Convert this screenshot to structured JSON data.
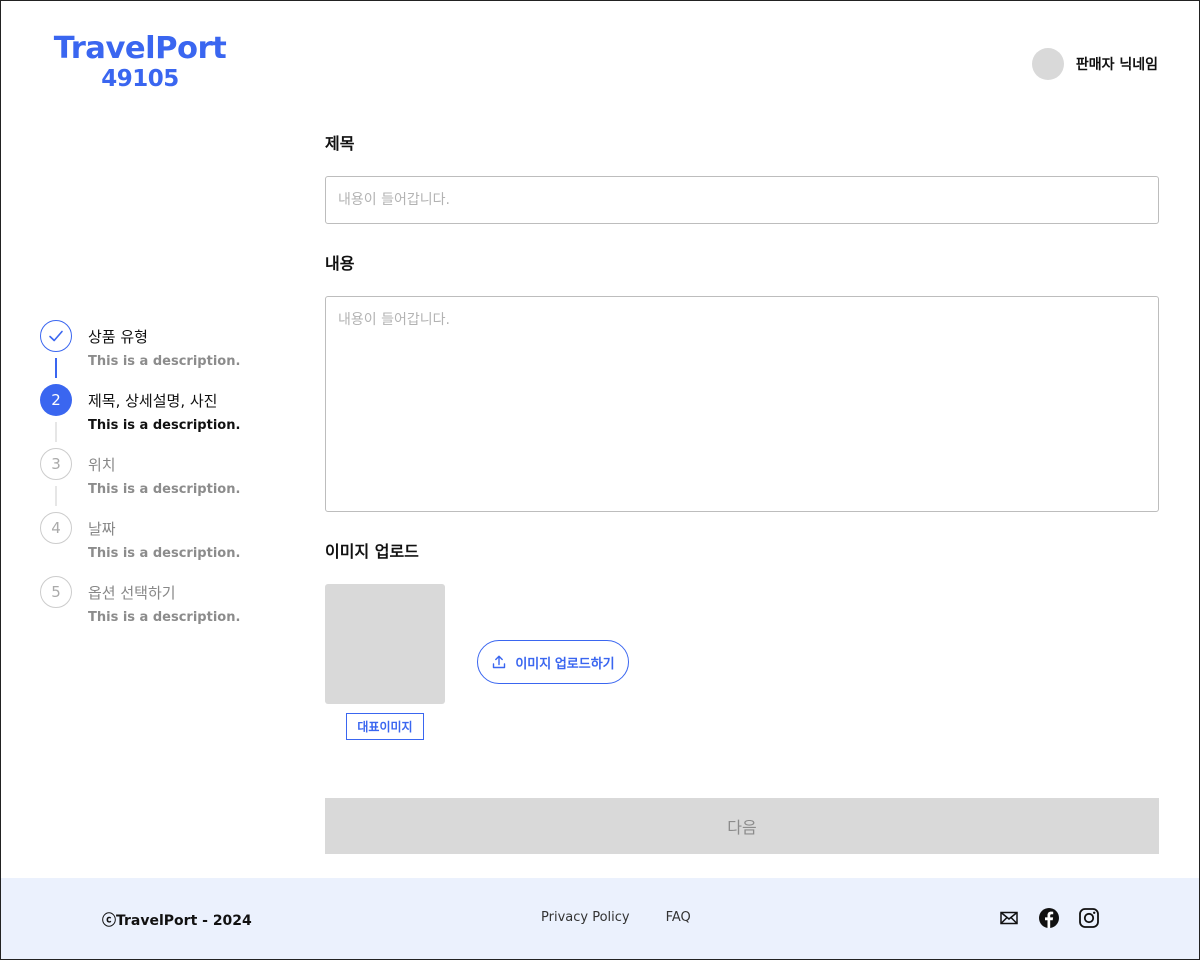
{
  "header": {
    "logo_line1": "TravelPort",
    "logo_line2": "49105",
    "seller_name": "판매자 닉네임"
  },
  "stepper": {
    "steps": [
      {
        "title": "상품 유형",
        "description": "This is a description.",
        "state": "done"
      },
      {
        "title": "제목, 상세설명, 사진",
        "description": "This is a description.",
        "state": "active",
        "number": "2"
      },
      {
        "title": "위치",
        "description": "This is a description.",
        "state": "todo",
        "number": "3"
      },
      {
        "title": "날짜",
        "description": "This is a description.",
        "state": "todo",
        "number": "4"
      },
      {
        "title": "옵션 선택하기",
        "description": "This is a description.",
        "state": "todo",
        "number": "5"
      }
    ]
  },
  "form": {
    "title_label": "제목",
    "title_placeholder": "내용이 들어갑니다.",
    "content_label": "내용",
    "content_placeholder": "내용이 들어갑니다.",
    "image_label": "이미지 업로드",
    "representative_tag": "대표이미지",
    "upload_button": "이미지 업로드하기",
    "next_button": "다음"
  },
  "footer": {
    "copyright": "ⓒTravelPort - 2024",
    "links": [
      "Privacy Policy",
      "FAQ"
    ],
    "social_icons": [
      "mail-icon",
      "facebook-icon",
      "instagram-icon"
    ]
  },
  "colors": {
    "accent": "#3a66f0",
    "footer_bg": "#ebf1fd",
    "disabled": "#d9d9d9"
  }
}
